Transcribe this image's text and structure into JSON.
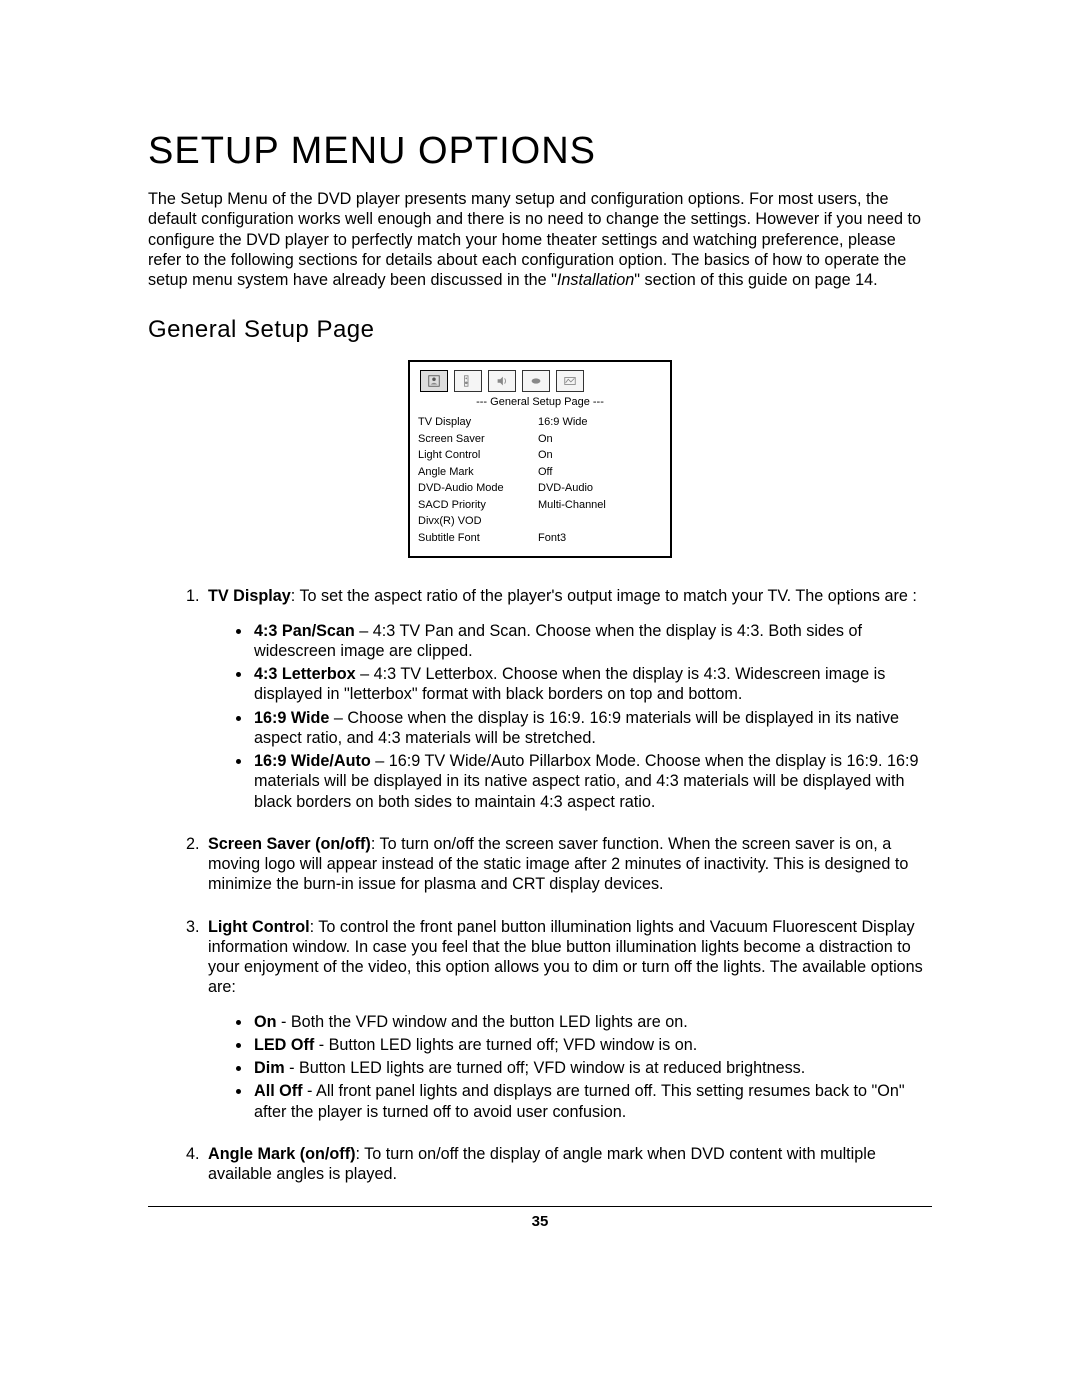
{
  "title": "SETUP MENU OPTIONS",
  "intro": {
    "pre": "The Setup Menu of the DVD player presents many setup and configuration options.  For most users, the default configuration works well enough and there is no need to change the settings.  However if you need to configure the DVD player to perfectly match your home theater settings and watching preference, please refer to the following sections for details about each configuration option.  The basics of how to operate the setup menu system have already been discussed in the \"",
    "italic": "Installation",
    "post": "\" section of this guide on page 14."
  },
  "section_heading": "General Setup Page",
  "osd": {
    "tabs": [
      "general-tab-icon",
      "speaker-tab-icon",
      "audio-tab-icon",
      "video-tab-icon",
      "preference-tab-icon"
    ],
    "caption": "--- General Setup Page ---",
    "rows": [
      {
        "k": "TV Display",
        "v": "16:9 Wide"
      },
      {
        "k": "Screen Saver",
        "v": "On"
      },
      {
        "k": "Light Control",
        "v": "On"
      },
      {
        "k": "Angle Mark",
        "v": "Off"
      },
      {
        "k": "DVD-Audio Mode",
        "v": "DVD-Audio"
      },
      {
        "k": "SACD Priority",
        "v": "Multi-Channel"
      },
      {
        "k": "Divx(R) VOD",
        "v": ""
      },
      {
        "k": "Subtitle Font",
        "v": "Font3"
      }
    ]
  },
  "items": {
    "i1": {
      "label": "TV Display",
      "text": ": To set the aspect ratio of the player's output image to match your TV.  The options are :",
      "sub": {
        "s0": {
          "b": "4:3 Pan/Scan",
          "t": " – 4:3 TV Pan and Scan.  Choose when the display is 4:3. Both sides of widescreen image are clipped."
        },
        "s1": {
          "b": "4:3 Letterbox",
          "t": " – 4:3 TV Letterbox.  Choose when the display is 4:3.  Widescreen image is displayed in \"letterbox\" format with black borders on top and bottom."
        },
        "s2": {
          "b": "16:9 Wide",
          "t": " – Choose when the display is 16:9.  16:9 materials will be displayed in its native aspect ratio, and 4:3 materials will be stretched."
        },
        "s3": {
          "b": "16:9 Wide/Auto",
          "t": " – 16:9 TV Wide/Auto Pillarbox Mode.  Choose when the display is 16:9.  16:9 materials will be displayed in its native aspect ratio, and 4:3 materials will be displayed with black borders on both sides to maintain 4:3 aspect ratio."
        }
      }
    },
    "i2": {
      "label": "Screen Saver (on/off)",
      "text": ": To turn on/off the screen saver function.  When the screen saver is on, a moving logo will appear instead of the static image after 2 minutes of inactivity.  This is designed to minimize the burn-in issue for plasma and CRT display devices."
    },
    "i3": {
      "label": "Light Control",
      "text": ": To control the front panel button illumination lights and Vacuum Fluorescent Display information window.  In case you feel that the blue button illumination lights become a distraction to your enjoyment of the video, this option allows you to dim or turn off the lights.  The available options are:",
      "sub": {
        "s0": {
          "b": "On",
          "t": " - Both the VFD window and the button LED lights are on."
        },
        "s1": {
          "b": "LED Off",
          "t": " - Button LED lights are turned off; VFD window is on."
        },
        "s2": {
          "b": "Dim",
          "t": " - Button LED lights are turned off; VFD window is at reduced brightness."
        },
        "s3": {
          "b": "All Off",
          "t": " - All front panel lights and displays are turned off. This setting resumes back to \"On\" after the player is turned off to avoid user confusion."
        }
      }
    },
    "i4": {
      "label": "Angle Mark (on/off)",
      "text": ": To turn on/off the display of angle mark when DVD content with multiple available angles is played."
    }
  },
  "page_number": "35"
}
